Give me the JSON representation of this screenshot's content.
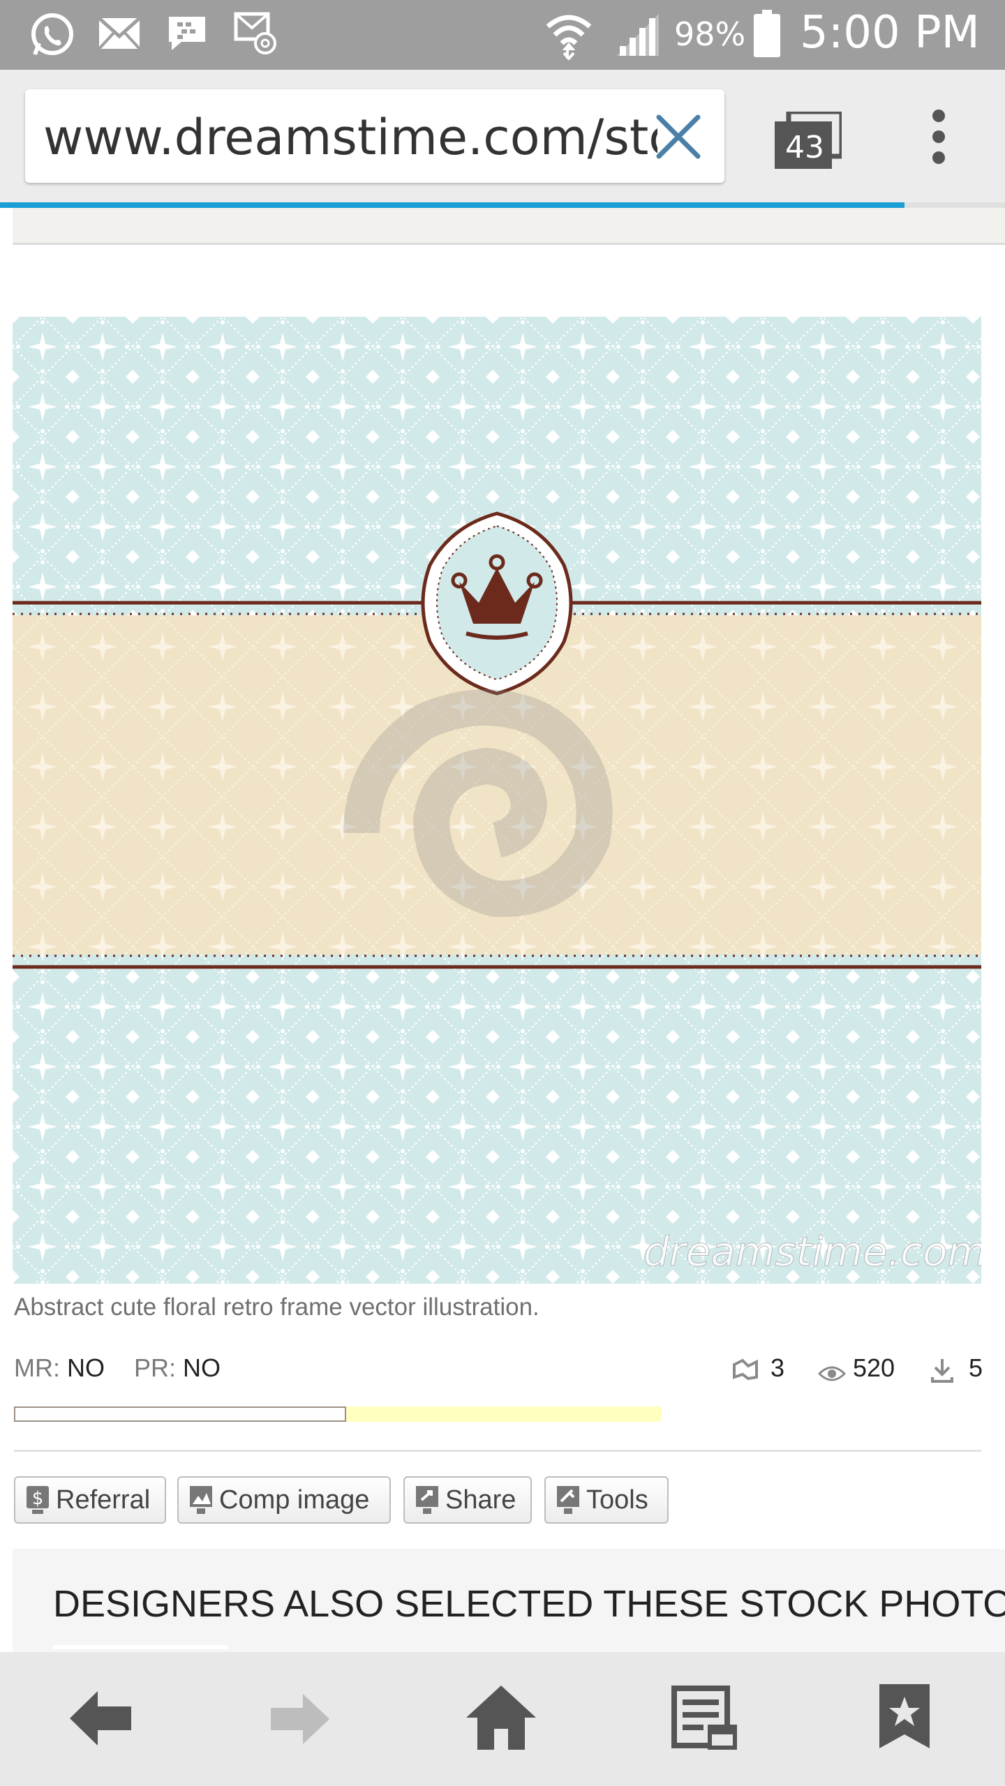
{
  "status_bar": {
    "battery": "98%",
    "time": "5:00 PM",
    "icons": [
      "whatsapp-icon",
      "email-icon",
      "bbm-icon",
      "mail-at-icon",
      "wifi-icon",
      "signal-icon",
      "battery-icon"
    ]
  },
  "browser": {
    "url": "www.dreamstime.com/stc",
    "tab_count": "43",
    "load_progress": 0.9
  },
  "image": {
    "watermark": "dreamstime.com",
    "colors": {
      "pattern_blue": "#cfe6e8",
      "band_beige": "#efe1c2",
      "frame_brown": "#6b2a1c"
    }
  },
  "detail": {
    "caption": "Abstract cute floral retro frame vector illustration.",
    "mr_label": "MR:",
    "mr_value": "NO",
    "pr_label": "PR:",
    "pr_value": "NO",
    "stats": {
      "similar": "3",
      "views": "520",
      "downloads": "5"
    }
  },
  "buttons": {
    "referral": "Referral",
    "comp_image": "Comp image",
    "share": "Share",
    "tools": "Tools"
  },
  "section": {
    "designers_title": "DESIGNERS ALSO SELECTED THESE STOCK PHOTO"
  },
  "nav": {
    "items": [
      "back-icon",
      "forward-icon",
      "home-icon",
      "reader-icon",
      "bookmarks-icon"
    ]
  }
}
